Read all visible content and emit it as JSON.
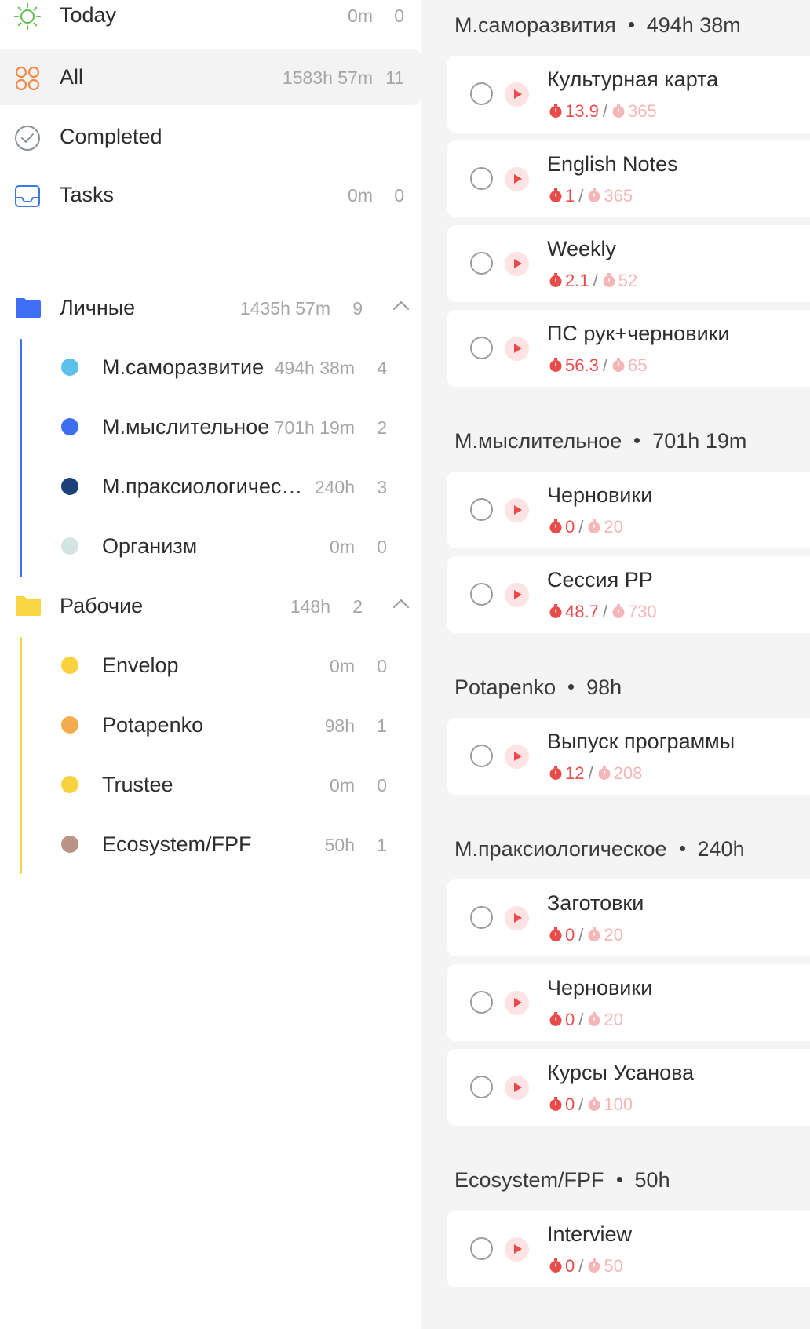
{
  "sidebar": {
    "smart_lists": [
      {
        "label": "Today",
        "duration": "0m",
        "count": "0",
        "icon": "sun-icon"
      },
      {
        "label": "All",
        "duration": "1583h 57m",
        "count": "11",
        "icon": "grid-circles-icon"
      },
      {
        "label": "Completed",
        "icon": "check-circle-icon"
      },
      {
        "label": "Tasks",
        "duration": "0m",
        "count": "0",
        "icon": "inbox-icon"
      }
    ],
    "folders": [
      {
        "label": "Личные",
        "duration": "1435h 57m",
        "count": "9",
        "color": "#3f6ff5",
        "projects": [
          {
            "label": "М.саморазвитие",
            "duration": "494h 38m",
            "count": "4",
            "color": "#5bc0ea"
          },
          {
            "label": "М.мыслительное",
            "duration": "701h 19m",
            "count": "2",
            "color": "#3d6ef0"
          },
          {
            "label": "М.праксиологическое",
            "duration": "240h",
            "count": "3",
            "color": "#1d3f7a"
          },
          {
            "label": "Организм",
            "duration": "0m",
            "count": "0",
            "color": "#d4e4e2"
          }
        ]
      },
      {
        "label": "Рабочие",
        "duration": "148h",
        "count": "2",
        "color": "#f7d544",
        "projects": [
          {
            "label": "Envelop",
            "duration": "0m",
            "count": "0",
            "color": "#f8d23f"
          },
          {
            "label": "Potapenko",
            "duration": "98h",
            "count": "1",
            "color": "#f3ac4b"
          },
          {
            "label": "Trustee",
            "duration": "0m",
            "count": "0",
            "color": "#f8d23f"
          },
          {
            "label": "Ecosystem/FPF",
            "duration": "50h",
            "count": "1",
            "color": "#b99487"
          }
        ]
      }
    ]
  },
  "main": {
    "groups": [
      {
        "name": "М.саморазвития",
        "total": "494h 38m",
        "tasks": [
          {
            "title": "Культурная карта",
            "done": "13.9",
            "estimate": "365"
          },
          {
            "title": "English Notes",
            "done": "1",
            "estimate": "365"
          },
          {
            "title": "Weekly",
            "done": "2.1",
            "estimate": "52"
          },
          {
            "title": "ПС рук+черновики",
            "done": "56.3",
            "estimate": "65"
          }
        ]
      },
      {
        "name": "М.мыслительное",
        "total": "701h 19m",
        "tasks": [
          {
            "title": "Черновики",
            "done": "0",
            "estimate": "20"
          },
          {
            "title": "Сессия РР",
            "done": "48.7",
            "estimate": "730"
          }
        ]
      },
      {
        "name": "Potapenko",
        "total": "98h",
        "tasks": [
          {
            "title": "Выпуск программы",
            "done": "12",
            "estimate": "208"
          }
        ]
      },
      {
        "name": "М.праксиологическое",
        "total": "240h",
        "tasks": [
          {
            "title": "Заготовки",
            "done": "0",
            "estimate": "20"
          },
          {
            "title": "Черновики",
            "done": "0",
            "estimate": "20"
          },
          {
            "title": "Курсы Усанова",
            "done": "0",
            "estimate": "100"
          }
        ]
      },
      {
        "name": "Ecosystem/FPF",
        "total": "50h",
        "tasks": [
          {
            "title": "Interview",
            "done": "0",
            "estimate": "50"
          }
        ]
      }
    ]
  },
  "colors": {
    "accent_red": "#e94b4b",
    "estimate_pink": "#f4b7b7",
    "sidebar_active": "#f3f3f3",
    "main_background": "#f4f4f4"
  }
}
